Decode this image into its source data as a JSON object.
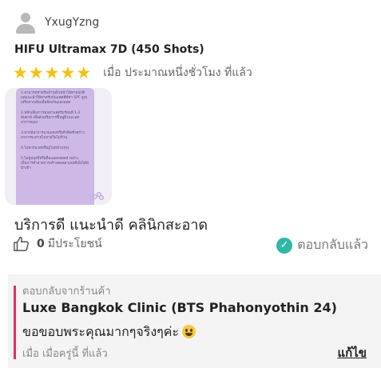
{
  "review": {
    "username": "YxugYzng",
    "product": "HIFU Ultramax 7D (450 Shots)",
    "rating": 5,
    "time_ago": "เมื่อ ประมาณหนึ่งชั่วโมง ที่แล้ว",
    "text": "บริการดี แนะนำดี คลินิกสะอาด",
    "image_lines": [
      "1.สามารถทาครีมบำรุงผิวหน้าได้ตามปกติ แต่แนะนำให้ทาครีมกันแดดที่มีค่า SPF สูงๆ เสริมจากเดิมเพื่อป้องกันแสงแดด",
      "2.หลีกเลี่ยงการอบตามสตรีมร้อนที่ 1-2 สัปดาห์ เพื่อส่งเสริมการฟื้นฟูผิวและลดอาการแดง",
      "3.หากมีอาการบวมแดงหรือสิวติดชั่วคราวอาการจะหายไปภายในไม่กี่วัน",
      "4.ไม่ควรนวดหรือถูไบหน้าแรงๆ",
      "5.ไม่สูบบุหรี่หรือดื่มแอลกอฮอล์ เพราะเป็นการทำลายการสร้างคอลลาเจนที่เพิ่งได้มีนำเข้า"
    ]
  },
  "likes": {
    "count": "0",
    "label": "มีประโยชน์"
  },
  "status": {
    "replied_label": "ตอบกลับแล้ว"
  },
  "reply": {
    "from_label": "ตอบกลับจากร้านค้า",
    "shop_name": "Luxe Bangkok Clinic (BTS Phahonyothin 24)",
    "message": "ขอขอบพระคุณมากๆจริงๆค่ะ",
    "time": "เมื่อ เมื่อครู่นี้ ที่แล้ว",
    "edit_label": "แก้ไข"
  },
  "colors": {
    "star": "#f3c20f",
    "check": "#2fb8a6",
    "accent_bar": "#e12a6c"
  }
}
